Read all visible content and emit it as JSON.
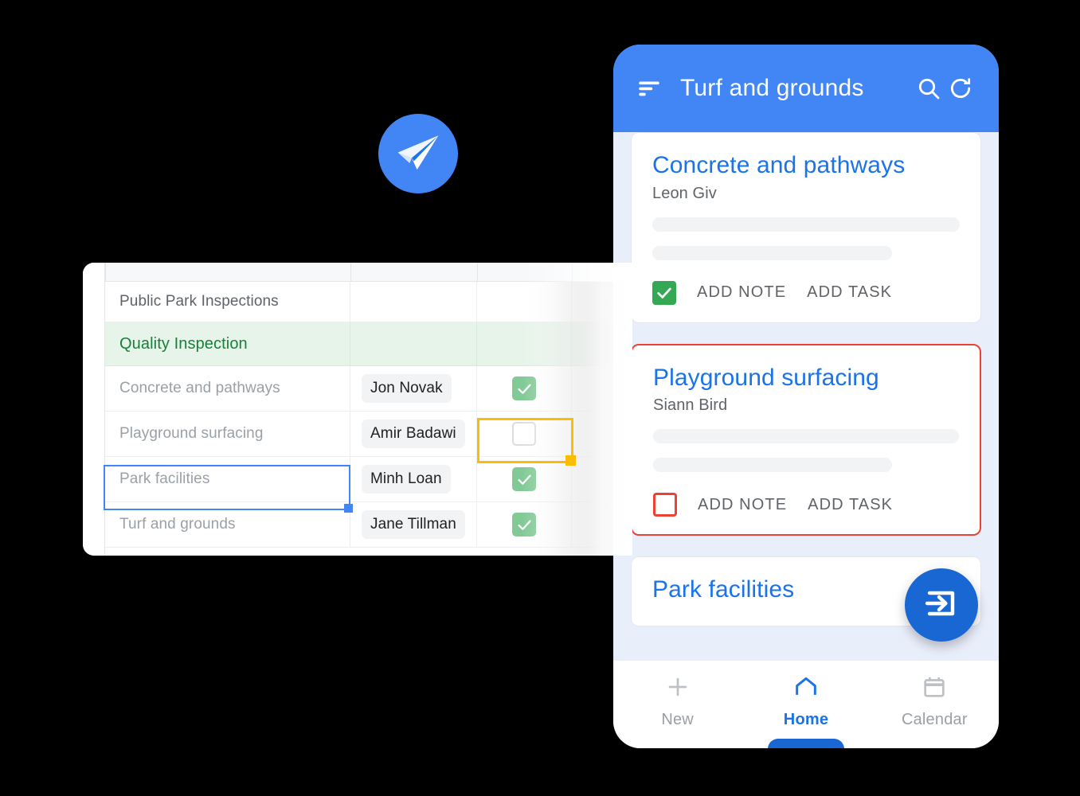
{
  "logo": {
    "icon": "paper-plane-icon",
    "circle_color": "#4285F4"
  },
  "spreadsheet": {
    "title_row": {
      "label": "Public Park Inspections"
    },
    "section_row": {
      "label": "Quality Inspection",
      "background": "#E6F4EA",
      "text_color": "#188038"
    },
    "rows": [
      {
        "task": "Concrete and pathways",
        "assignee": "Jon Novak",
        "done": true
      },
      {
        "task": "Playground surfacing",
        "assignee": "Amir Badawi",
        "done": false
      },
      {
        "task": "Park facilities",
        "assignee": "Minh Loan",
        "done": true
      },
      {
        "task": "Turf and grounds",
        "assignee": "Jane Tillman",
        "done": true
      }
    ],
    "selection": {
      "primary_cell": "Park facilities",
      "primary_color": "#4285F4",
      "secondary_cell": "Playground surfacing checkbox",
      "secondary_color": "#FBBC04"
    },
    "checkbox_on_color": "#81C995"
  },
  "phone": {
    "appbar": {
      "sort_icon": "sort-icon",
      "title": "Turf and grounds",
      "search_icon": "search-icon",
      "refresh_icon": "refresh-icon",
      "background": "#4285F4"
    },
    "cards": [
      {
        "title": "Concrete and pathways",
        "assignee": "Leon Giv",
        "checkbox": "checked",
        "checkbox_color": "#34A853",
        "add_note": "ADD NOTE",
        "add_task": "ADD TASK",
        "border": "none"
      },
      {
        "title": "Playground surfacing",
        "assignee": "Siann Bird",
        "checkbox": "unchecked",
        "checkbox_color": "#EA4335",
        "add_note": "ADD NOTE",
        "add_task": "ADD TASK",
        "border": "#EA4335"
      },
      {
        "title": "Park facilities",
        "assignee": "",
        "checkbox": "",
        "checkbox_color": "",
        "add_note": "",
        "add_task": "",
        "border": "none"
      }
    ],
    "fab": {
      "icon": "login-arrow-icon",
      "color": "#1967D2"
    },
    "bottom_nav": {
      "items": [
        {
          "label": "New",
          "icon": "plus-icon",
          "active": false
        },
        {
          "label": "Home",
          "icon": "home-icon",
          "active": true
        },
        {
          "label": "Calendar",
          "icon": "calendar-icon",
          "active": false
        }
      ],
      "active_color": "#1A73E8",
      "inactive_color": "#9AA0A6"
    }
  }
}
